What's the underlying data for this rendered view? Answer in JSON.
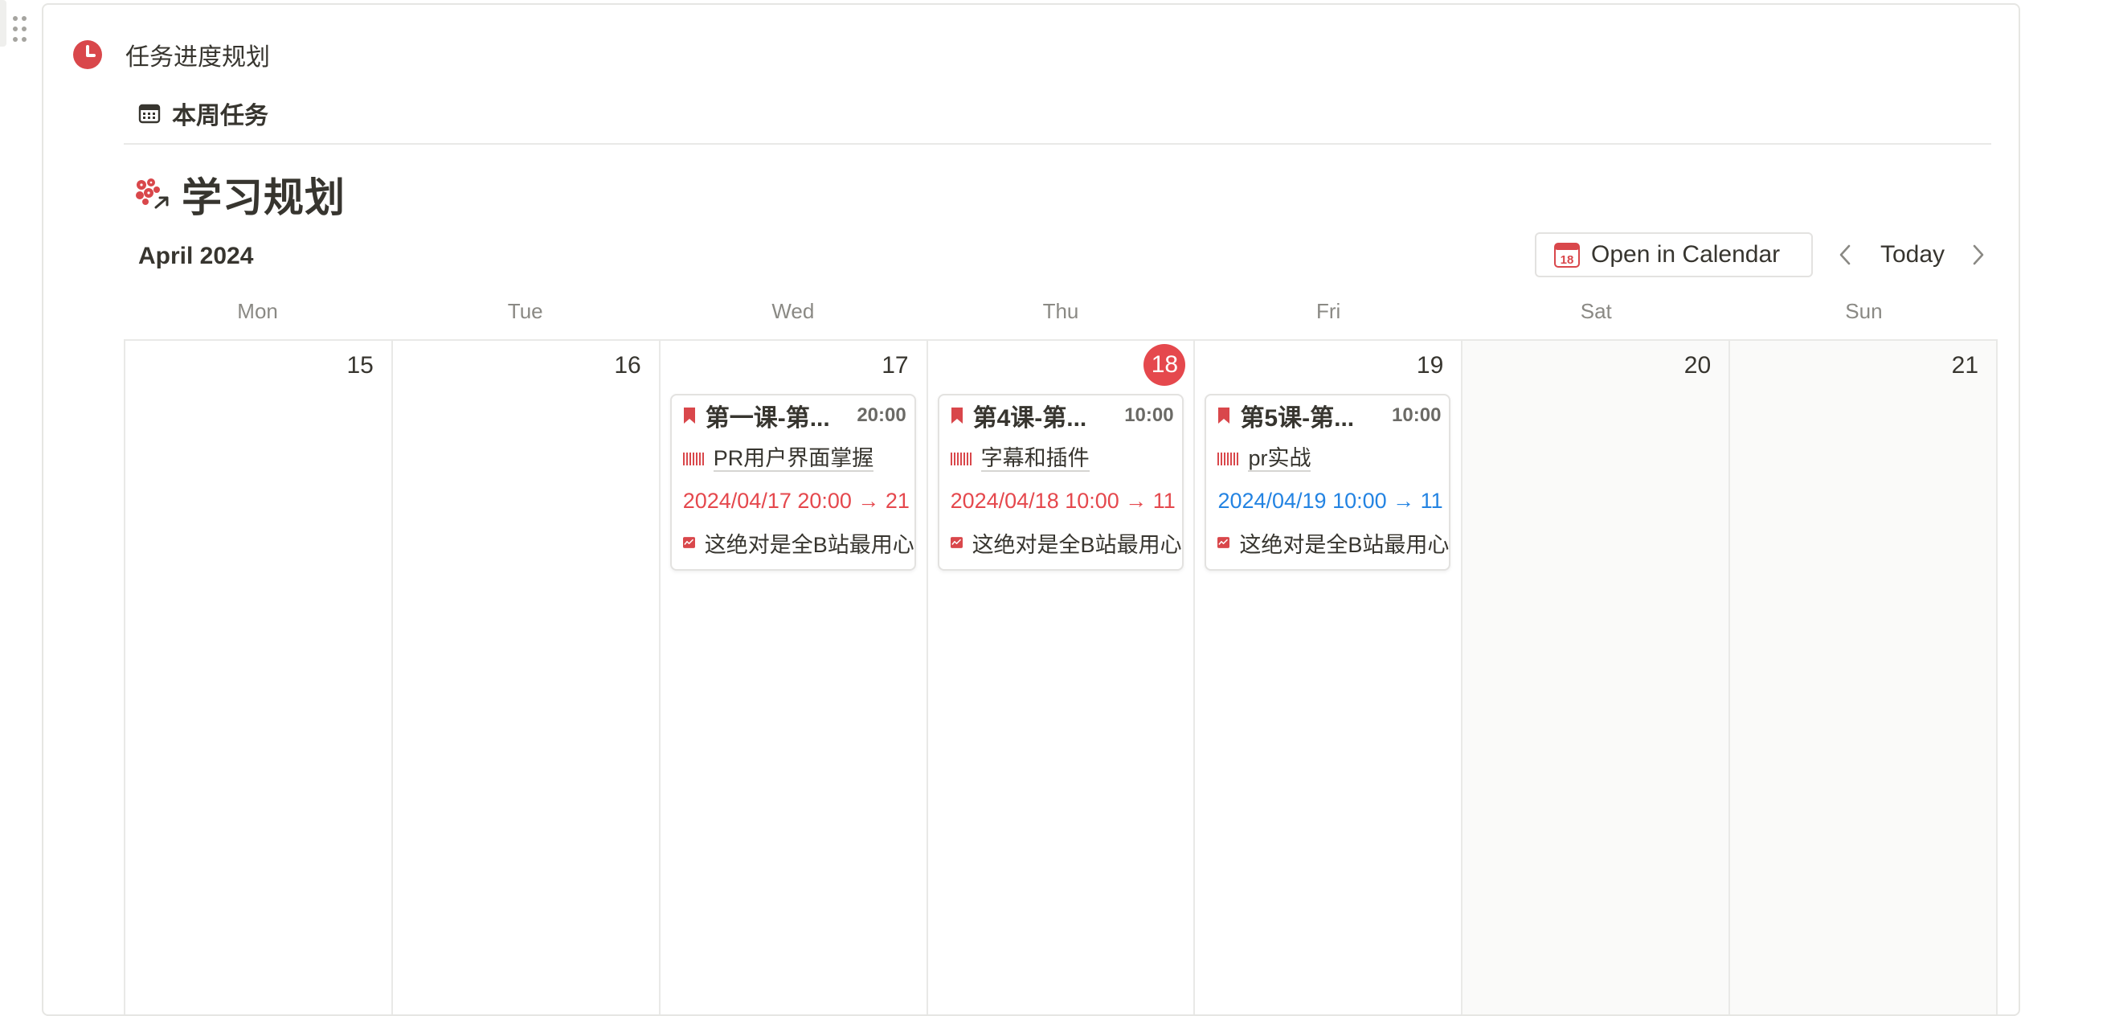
{
  "page": {
    "block_title": "任务进度规划",
    "view_tab": "本周任务",
    "database_title": "学习规划"
  },
  "calendar": {
    "month": "April 2024",
    "open_button": "Open in Calendar",
    "open_icon_day": "18",
    "today_label": "Today",
    "weekdays": [
      "Mon",
      "Tue",
      "Wed",
      "Thu",
      "Fri",
      "Sat",
      "Sun"
    ],
    "days": [
      "15",
      "16",
      "17",
      "18",
      "19",
      "20",
      "21"
    ],
    "today_index": 3
  },
  "cards": [
    {
      "day": "17",
      "title": "第一课-第...",
      "time": "20:00",
      "relation": "PR用户界面掌握",
      "date_range": "2024/04/17 20:00 → 21",
      "date_color": "red",
      "link": "这绝对是全B站最用心"
    },
    {
      "day": "18",
      "title": "第4课-第...",
      "time": "10:00",
      "relation": "字幕和插件",
      "date_range": "2024/04/18 10:00 → 11",
      "date_color": "red",
      "link": "这绝对是全B站最用心"
    },
    {
      "day": "19",
      "title": "第5课-第...",
      "time": "10:00",
      "relation": "pr实战",
      "date_range": "2024/04/19 10:00 → 11",
      "date_color": "blue",
      "link": "这绝对是全B站最用心"
    }
  ],
  "colors": {
    "accent_red": "#e5484d",
    "accent_blue": "#2383e2",
    "text": "#37352f",
    "muted": "#8a8984"
  },
  "icons": {
    "block": "clock-icon",
    "view": "calendar-view-icon",
    "database": "dots-arrow-icon",
    "card_title": "bookmark-icon",
    "card_relation": "barcode-icon",
    "card_link": "trend-chart-icon"
  }
}
